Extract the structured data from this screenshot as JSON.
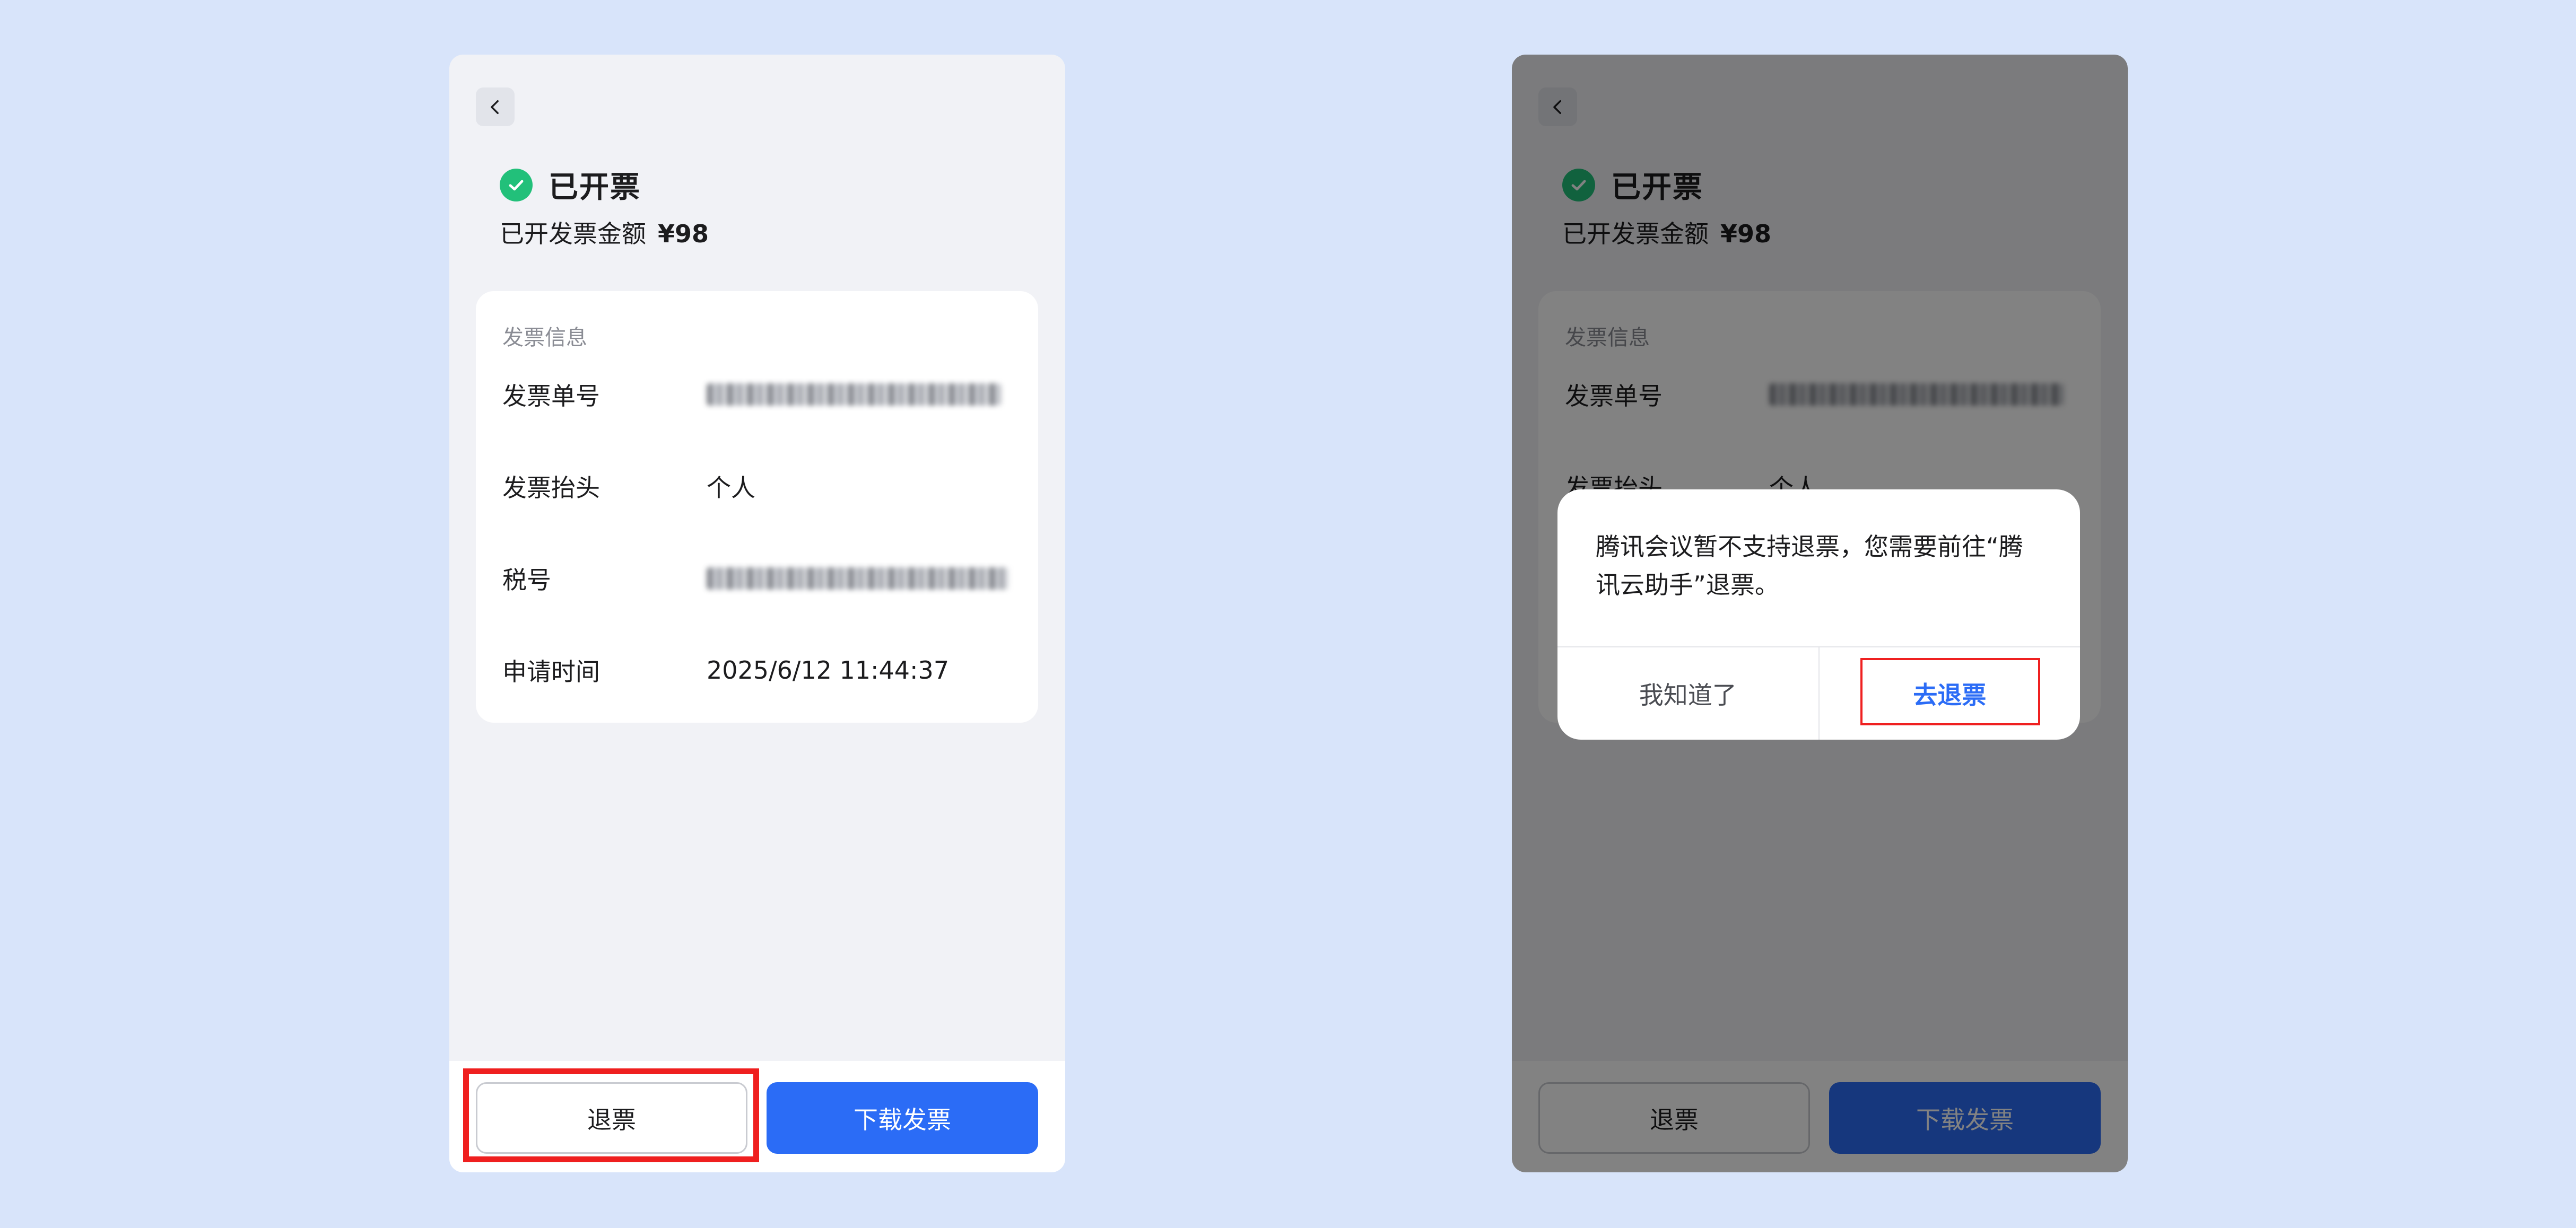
{
  "status": {
    "title": "已开票",
    "icon": "check-circle-icon",
    "icon_color": "#22c07a"
  },
  "amount": {
    "label": "已开发票金额",
    "value": "¥98"
  },
  "invoice_card": {
    "section_title": "发票信息",
    "rows": [
      {
        "label": "发票单号",
        "value": ""
      },
      {
        "label": "发票抬头",
        "value": "个人"
      },
      {
        "label": "税号",
        "value": ""
      },
      {
        "label": "申请时间",
        "value": "2025/6/12 11:44:37"
      }
    ]
  },
  "actions": {
    "refund_label": "退票",
    "download_label": "下载发票"
  },
  "dialog": {
    "message": "腾讯会议暂不支持退票，您需要前往“腾讯云助手”退票。",
    "cancel_label": "我知道了",
    "confirm_label": "去退票"
  },
  "colors": {
    "accent": "#2b6cf6",
    "highlight": "#ef1f1f",
    "background": "#d8e4fa"
  }
}
